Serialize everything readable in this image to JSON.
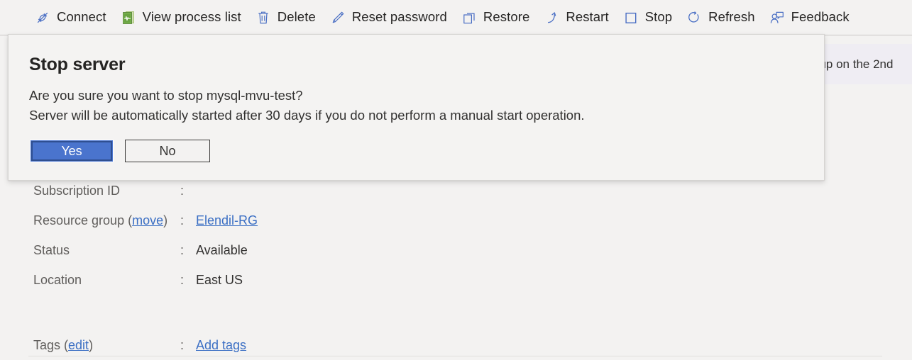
{
  "command_bar": {
    "items": [
      {
        "label": "Connect",
        "icon": "connect-plug-icon"
      },
      {
        "label": "View process list",
        "icon": "process-list-icon"
      },
      {
        "label": "Delete",
        "icon": "trash-icon"
      },
      {
        "label": "Reset password",
        "icon": "pencil-icon"
      },
      {
        "label": "Restore",
        "icon": "restore-copy-icon"
      },
      {
        "label": "Restart",
        "icon": "restart-arrow-icon"
      },
      {
        "label": "Stop",
        "icon": "stop-square-icon"
      },
      {
        "label": "Refresh",
        "icon": "refresh-circle-icon"
      },
      {
        "label": "Feedback",
        "icon": "feedback-person-icon"
      }
    ]
  },
  "notification_banner": {
    "text": "oup on the 2nd"
  },
  "essentials": {
    "rows": [
      {
        "label": "Subscription ID",
        "colon": ":",
        "value": "",
        "value_is_link": false
      },
      {
        "label": "Resource group",
        "label_suffix_open": " (",
        "label_link": "move",
        "label_suffix_close": ")",
        "colon": ":",
        "value": "Elendil-RG",
        "value_is_link": true
      },
      {
        "label": "Status",
        "colon": ":",
        "value": "Available",
        "value_is_link": false
      },
      {
        "label": "Location",
        "colon": ":",
        "value": "East US",
        "value_is_link": false
      },
      {
        "label": "Tags",
        "label_suffix_open": " (",
        "label_link": "edit",
        "label_suffix_close": ")",
        "colon": ":",
        "value": "Add tags",
        "value_is_link": true
      }
    ]
  },
  "dialog": {
    "title": "Stop server",
    "message_line1": "Are you sure you want to stop mysql-mvu-test?",
    "message_line2": "Server will be automatically started after 30 days if you do not perform a manual start operation.",
    "yes_label": "Yes",
    "no_label": "No"
  },
  "colors": {
    "accent_blue": "#4a74cd",
    "icon_blue": "#4a6fc4",
    "link_blue": "#3b6fc4",
    "page_background": "#f3f2f1",
    "banner_background": "#efedf3",
    "dialog_background": "#f4f3f2"
  }
}
